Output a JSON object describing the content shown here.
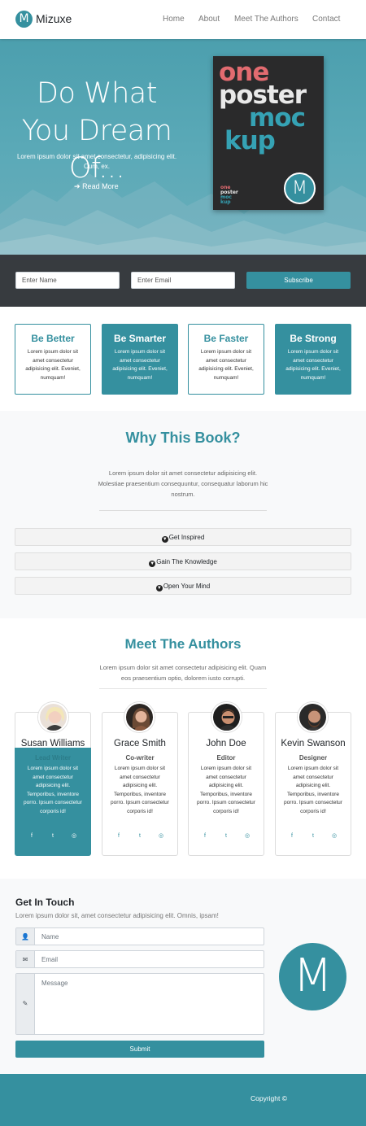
{
  "colors": {
    "accent": "#35909f",
    "dark_band": "#373b3f",
    "light_bg": "#f8f9fa"
  },
  "nav": {
    "logo_letter": "M",
    "brand": "Mizuxe",
    "links": [
      "Home",
      "About",
      "Meet The Authors",
      "Contact"
    ]
  },
  "hero": {
    "title_line1": "Do What",
    "title_line2": "You Dream",
    "title_line3": "Of...",
    "subtitle": "Lorem ipsum dolor sit amet consectetur, adipisicing elit. Cum, ex.",
    "read_more": "Read More",
    "read_more_icon": "arrow-right-icon",
    "poster": {
      "word1": "one",
      "word2": "poster",
      "word3": "moc",
      "word4": "kup",
      "small1": "one",
      "small2": "poster",
      "small3": "moc",
      "small4": "kup",
      "badge": "M"
    }
  },
  "subscribe": {
    "name_placeholder": "Enter Name",
    "email_placeholder": "Enter Email",
    "button": "Subscribe"
  },
  "features": [
    {
      "title": "Be Better",
      "text": "Lorem ipsum dolor sit amet consectetur adipisicing elit. Eveniet, numquam!"
    },
    {
      "title": "Be Smarter",
      "text": "Lorem ipsum dolor sit amet consectetur adipisicing elit. Eveniet, numquam!"
    },
    {
      "title": "Be Faster",
      "text": "Lorem ipsum dolor sit amet consectetur adipisicing elit. Eveniet, numquam!"
    },
    {
      "title": "Be Strong",
      "text": "Lorem ipsum dolor sit amet consectetur adipisicing elit. Eveniet, numquam!"
    }
  ],
  "why": {
    "title": "Why This Book?",
    "text": "Lorem ipsum dolor sit amet consectetur adipisicing elit. Molestiae praesentium consequuntur, consequatur laborum hic nostrum.",
    "items": [
      "Get Inspired",
      "Gain The Knowledge",
      "Open Your Mind"
    ],
    "item_icon": "arrow-circle-down-icon"
  },
  "authors": {
    "title": "Meet The Authors",
    "subtitle": "Lorem ipsum dolor sit amet consectetur adipisicing elit. Quam eos praesentium optio, dolorem iusto corrupti.",
    "people": [
      {
        "name": "Susan Williams",
        "role": "Lead Writer",
        "text": "Lorem ipsum dolor sit amet consectetur adipisicing elit. Temporibus, inventore porro. Ipsum consectetur corporis id!"
      },
      {
        "name": "Grace Smith",
        "role": "Co-writer",
        "text": "Lorem ipsum dolor sit amet consectetur adipisicing elit. Temporibus, inventore porro. Ipsum consectetur corporis id!"
      },
      {
        "name": "John Doe",
        "role": "Editor",
        "text": "Lorem ipsum dolor sit amet consectetur adipisicing elit. Temporibus, inventore porro. Ipsum consectetur corporis id!"
      },
      {
        "name": "Kevin Swanson",
        "role": "Designer",
        "text": "Lorem ipsum dolor sit amet consectetur adipisicing elit. Temporibus, inventore porro. Ipsum consectetur corporis id!"
      }
    ],
    "social_icons": [
      "facebook-icon",
      "twitter-icon",
      "instagram-icon"
    ]
  },
  "contact": {
    "title": "Get In Touch",
    "subtitle": "Lorem ipsum dolor sit, amet consectetur adipisicing elit. Omnis, ipsam!",
    "name_placeholder": "Name",
    "email_placeholder": "Email",
    "message_placeholder": "Message",
    "submit": "Submit",
    "logo_letter": "M"
  },
  "footer": {
    "copyright": "Copyright ©"
  }
}
